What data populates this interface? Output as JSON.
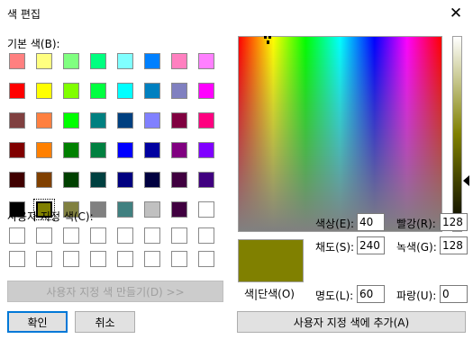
{
  "window": {
    "title": "색 편집",
    "close_glyph": "✕"
  },
  "basic": {
    "label": "기본 색(B):",
    "colors": [
      "#ff8080",
      "#ffff80",
      "#80ff80",
      "#00ff80",
      "#80ffff",
      "#0080ff",
      "#ff80c0",
      "#ff80ff",
      "#ff0000",
      "#ffff00",
      "#80ff00",
      "#00ff40",
      "#00ffff",
      "#0080c0",
      "#8080c0",
      "#ff00ff",
      "#804040",
      "#ff8040",
      "#00ff00",
      "#008080",
      "#004080",
      "#8080ff",
      "#800040",
      "#ff0080",
      "#800000",
      "#ff8000",
      "#008000",
      "#008040",
      "#0000ff",
      "#0000a0",
      "#800080",
      "#8000ff",
      "#400000",
      "#804000",
      "#004000",
      "#004040",
      "#000080",
      "#000040",
      "#400040",
      "#400080",
      "#000000",
      "#808000",
      "#808040",
      "#808080",
      "#408080",
      "#c0c0c0",
      "#400040",
      "#ffffff"
    ],
    "selected_index": 41
  },
  "custom": {
    "label": "사용자 지정 색(C):",
    "colors": [
      "#ffffff",
      "#ffffff",
      "#ffffff",
      "#ffffff",
      "#ffffff",
      "#ffffff",
      "#ffffff",
      "#ffffff",
      "#ffffff",
      "#ffffff",
      "#ffffff",
      "#ffffff",
      "#ffffff",
      "#ffffff",
      "#ffffff",
      "#ffffff"
    ]
  },
  "buttons": {
    "define_custom": "사용자 지정 색 만들기(D) >>",
    "ok": "확인",
    "cancel": "취소",
    "add_custom": "사용자 지정 색에 추가(A)"
  },
  "preview": {
    "label": "색|단색(O)",
    "color": "#808000"
  },
  "fields": {
    "hue": {
      "label": "색상(E):",
      "value": "40"
    },
    "sat": {
      "label": "채도(S):",
      "value": "240"
    },
    "lum": {
      "label": "명도(L):",
      "value": "60"
    },
    "red": {
      "label": "빨강(R):",
      "value": "128"
    },
    "green": {
      "label": "녹색(G):",
      "value": "128"
    },
    "blue": {
      "label": "파랑(U):",
      "value": "0"
    }
  },
  "accent": "#0078d7"
}
